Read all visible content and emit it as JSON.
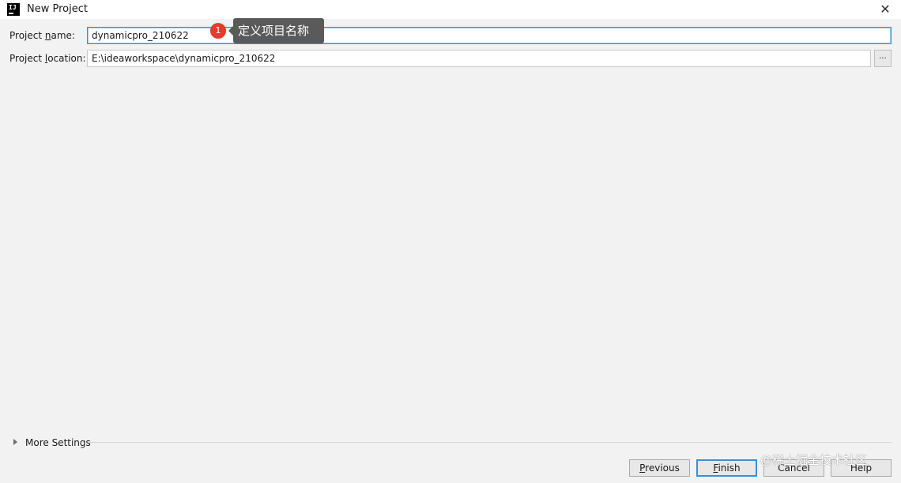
{
  "window": {
    "title": "New Project",
    "app_icon": "intellij-idea-icon",
    "app_icon_text": "IJ",
    "close_icon": "close-icon",
    "close_glyph": "✕"
  },
  "form": {
    "name_label_pre": "Project ",
    "name_label_mnemonic": "n",
    "name_label_post": "ame:",
    "name_value": "dynamicpro_210622",
    "location_label_pre": "Project ",
    "location_label_mnemonic": "l",
    "location_label_post": "ocation:",
    "location_value": "E:\\ideaworkspace\\dynamicpro_210622",
    "browse_label": "..."
  },
  "annotation": {
    "number": "1",
    "text": "定义项目名称",
    "badge_color": "#e63b2e",
    "tooltip_color": "#5a5a5a"
  },
  "more_settings": {
    "label": "More Settings",
    "icon": "expand-triangle-icon"
  },
  "buttons": {
    "previous_mnemonic": "P",
    "previous_rest": "revious",
    "finish_mnemonic": "F",
    "finish_rest": "inish",
    "cancel": "Cancel",
    "help": "Help"
  },
  "watermark": "@稀土掘金技术社区",
  "colors": {
    "focus_border": "#3d8fd1",
    "dialog_background": "#f2f2f2"
  }
}
